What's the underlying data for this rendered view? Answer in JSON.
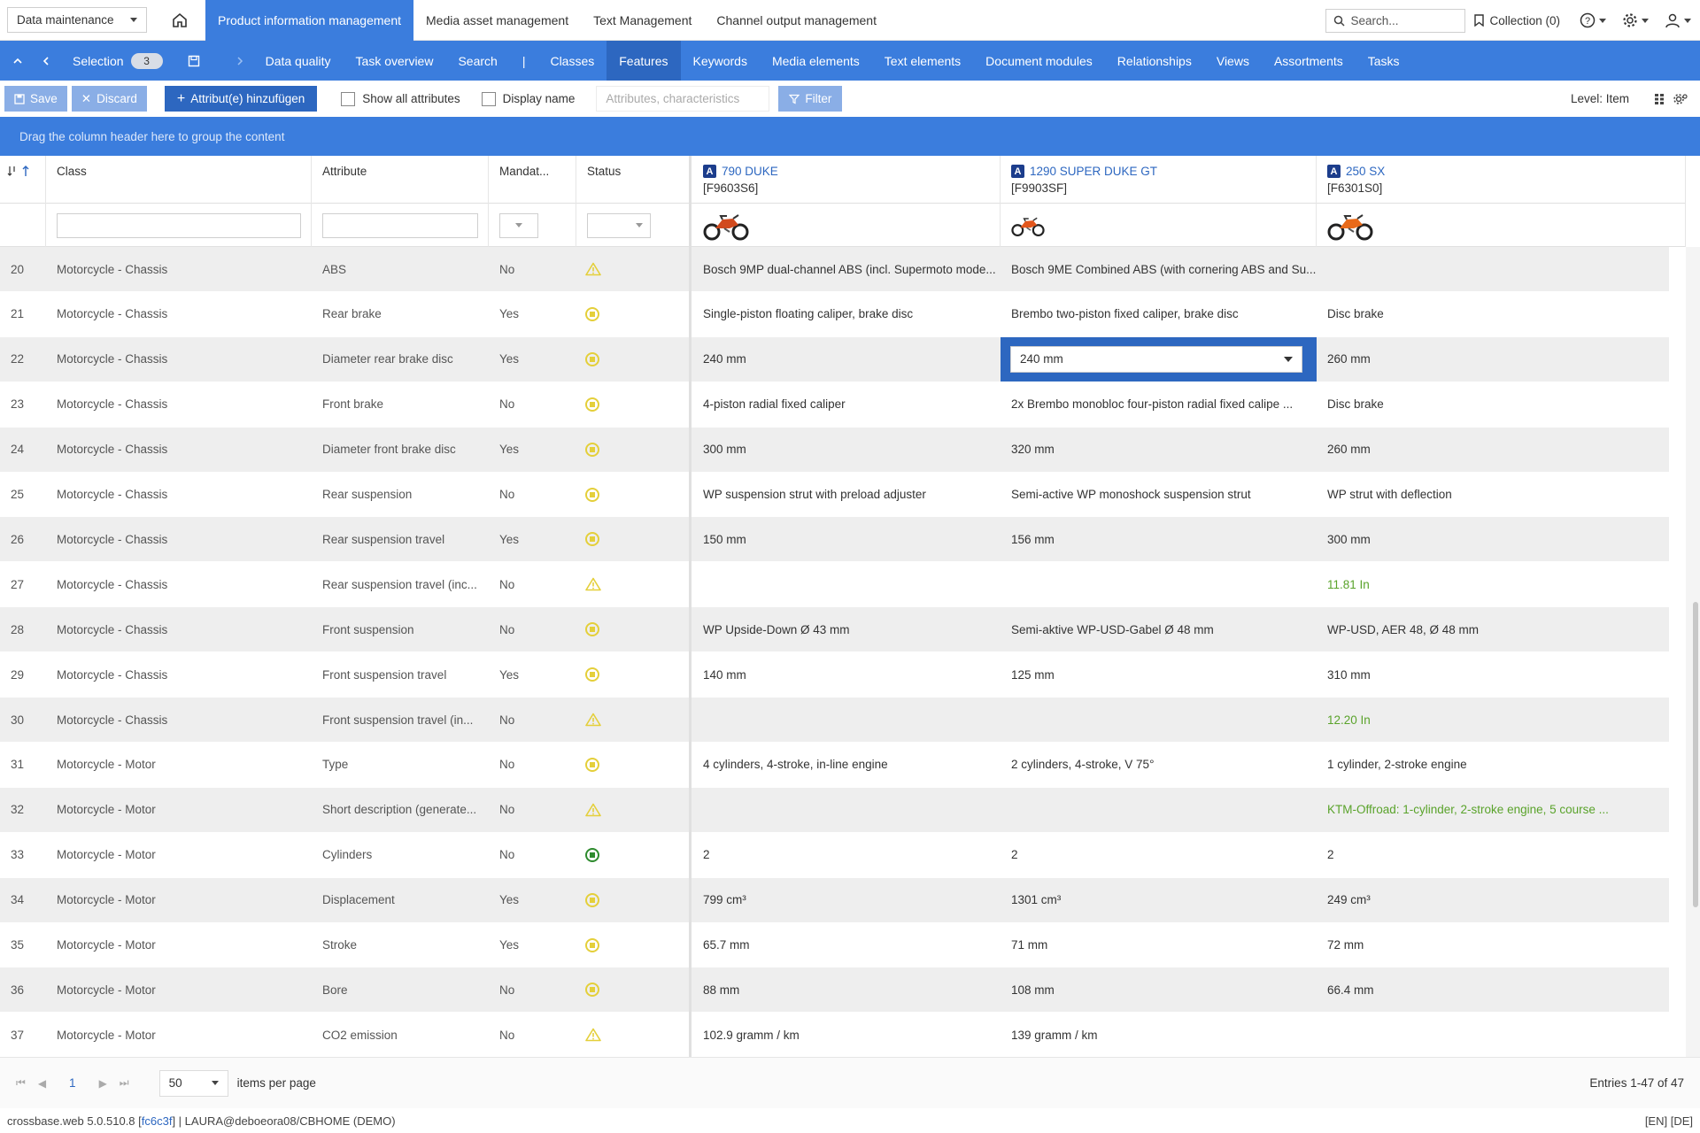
{
  "topbar": {
    "module_select": "Data maintenance",
    "nav": [
      "Product information management",
      "Media asset management",
      "Text Management",
      "Channel output management"
    ],
    "active_nav": 0,
    "search_placeholder": "Search...",
    "collection": "Collection (0)"
  },
  "bluenav": {
    "selection_label": "Selection",
    "selection_count": "3",
    "items": [
      "Data quality",
      "Task overview",
      "Search",
      "|",
      "Classes",
      "Features",
      "Keywords",
      "Media elements",
      "Text elements",
      "Document modules",
      "Relationships",
      "Views",
      "Assortments",
      "Tasks"
    ],
    "active_item": "Features"
  },
  "toolbar": {
    "save": "Save",
    "discard": "Discard",
    "add_attribute": "Attribut(e) hinzufügen",
    "show_all": "Show all attributes",
    "display_name": "Display name",
    "attr_placeholder": "Attributes, characteristics",
    "filter": "Filter",
    "level": "Level: Item"
  },
  "group_hint": "Drag the column header here to group the content",
  "columns": {
    "class": "Class",
    "attribute": "Attribute",
    "mandatory": "Mandat...",
    "status": "Status"
  },
  "products": [
    {
      "badge": "A",
      "name": "790 DUKE",
      "code": "[F9603S6]",
      "bike_color": "#d14a1e"
    },
    {
      "badge": "A",
      "name": "1290 SUPER DUKE GT",
      "code": "[F9903SF]",
      "bike_color": "#e3561c"
    },
    {
      "badge": "A",
      "name": "250 SX",
      "code": "[F6301S0]",
      "bike_color": "#e86a1a"
    }
  ],
  "rows": [
    {
      "n": "20",
      "cls": "Motorcycle - Chassis",
      "attr": "ABS",
      "mand": "No",
      "status": "warn",
      "p1": "Bosch 9MP dual-channel ABS (incl. Supermoto mode...",
      "p2": "Bosch 9ME Combined ABS (with cornering ABS and Su...",
      "p3": "",
      "p3green": false
    },
    {
      "n": "21",
      "cls": "Motorcycle - Chassis",
      "attr": "Rear brake",
      "mand": "Yes",
      "status": "pending",
      "p1": "Single-piston floating caliper, brake disc",
      "p2": "Brembo two-piston fixed caliper, brake disc",
      "p3": "Disc brake",
      "p3green": false
    },
    {
      "n": "22",
      "cls": "Motorcycle - Chassis",
      "attr": "Diameter rear brake disc",
      "mand": "Yes",
      "status": "pending",
      "p1": "240 mm",
      "p2": "240 mm",
      "p3": "260 mm",
      "p3green": false,
      "editing": true
    },
    {
      "n": "23",
      "cls": "Motorcycle - Chassis",
      "attr": "Front brake",
      "mand": "No",
      "status": "pending",
      "p1": "4-piston radial fixed caliper",
      "p2": "2x Brembo monobloc four-piston radial fixed calipe ...",
      "p3": "Disc brake",
      "p3green": false
    },
    {
      "n": "24",
      "cls": "Motorcycle - Chassis",
      "attr": "Diameter front brake disc",
      "mand": "Yes",
      "status": "pending",
      "p1": "300 mm",
      "p2": "320 mm",
      "p3": "260 mm",
      "p3green": false
    },
    {
      "n": "25",
      "cls": "Motorcycle - Chassis",
      "attr": "Rear suspension",
      "mand": "No",
      "status": "pending",
      "p1": "WP suspension strut with preload adjuster",
      "p2": "Semi-active WP monoshock suspension strut",
      "p3": "WP strut with deflection",
      "p3green": false
    },
    {
      "n": "26",
      "cls": "Motorcycle - Chassis",
      "attr": "Rear suspension travel",
      "mand": "Yes",
      "status": "pending",
      "p1": "150 mm",
      "p2": "156 mm",
      "p3": "300 mm",
      "p3green": false
    },
    {
      "n": "27",
      "cls": "Motorcycle - Chassis",
      "attr": "Rear suspension travel (inc...",
      "mand": "No",
      "status": "warn",
      "p1": "",
      "p2": "",
      "p3": "11.81 In",
      "p3green": true
    },
    {
      "n": "28",
      "cls": "Motorcycle - Chassis",
      "attr": "Front suspension",
      "mand": "No",
      "status": "pending",
      "p1": "WP Upside-Down Ø 43 mm",
      "p2": "Semi-aktive WP-USD-Gabel Ø 48 mm",
      "p3": "WP-USD, AER 48, Ø 48 mm",
      "p3green": false
    },
    {
      "n": "29",
      "cls": "Motorcycle - Chassis",
      "attr": "Front suspension travel",
      "mand": "Yes",
      "status": "pending",
      "p1": "140 mm",
      "p2": "125 mm",
      "p3": "310 mm",
      "p3green": false
    },
    {
      "n": "30",
      "cls": "Motorcycle - Chassis",
      "attr": "Front suspension travel (in...",
      "mand": "No",
      "status": "warn",
      "p1": "",
      "p2": "",
      "p3": "12.20 In",
      "p3green": true
    },
    {
      "n": "31",
      "cls": "Motorcycle - Motor",
      "attr": "Type",
      "mand": "No",
      "status": "pending",
      "p1": "4 cylinders, 4-stroke, in-line engine",
      "p2": "2 cylinders, 4-stroke, V 75°",
      "p3": "1 cylinder, 2-stroke engine",
      "p3green": false
    },
    {
      "n": "32",
      "cls": "Motorcycle - Motor",
      "attr": "Short description (generate...",
      "mand": "No",
      "status": "warn",
      "p1": "",
      "p2": "",
      "p3": "KTM-Offroad: 1-cylinder, 2-stroke engine, 5 course ...",
      "p3green": true
    },
    {
      "n": "33",
      "cls": "Motorcycle - Motor",
      "attr": "Cylinders",
      "mand": "No",
      "status": "ok",
      "p1": "2",
      "p2": "2",
      "p3": "2",
      "p3green": false
    },
    {
      "n": "34",
      "cls": "Motorcycle - Motor",
      "attr": "Displacement",
      "mand": "Yes",
      "status": "pending",
      "p1": "799 cm³",
      "p2": "1301 cm³",
      "p3": "249 cm³",
      "p3green": false
    },
    {
      "n": "35",
      "cls": "Motorcycle - Motor",
      "attr": "Stroke",
      "mand": "Yes",
      "status": "pending",
      "p1": "65.7 mm",
      "p2": "71 mm",
      "p3": "72 mm",
      "p3green": false
    },
    {
      "n": "36",
      "cls": "Motorcycle - Motor",
      "attr": "Bore",
      "mand": "No",
      "status": "pending",
      "p1": "88 mm",
      "p2": "108 mm",
      "p3": "66.4 mm",
      "p3green": false
    },
    {
      "n": "37",
      "cls": "Motorcycle - Motor",
      "attr": "CO2 emission",
      "mand": "No",
      "status": "warn",
      "p1": "102.9 gramm / km",
      "p2": "139 gramm / km",
      "p3": "",
      "p3green": false
    }
  ],
  "pager": {
    "page": "1",
    "items_per_page": "50",
    "items_per_page_label": "items per page",
    "entries": "Entries 1-47 of 47"
  },
  "statusbar": {
    "version_prefix": "crossbase.web 5.0.510.8 [",
    "build": "fc6c3f",
    "version_suffix": "] | LAURA@deboeora08/CBHOME (DEMO)",
    "lang": "[EN] [DE]"
  },
  "colors": {
    "primary": "#3b7ddd",
    "primary_dark": "#2d67c0",
    "warn": "#e4cf3a",
    "ok": "#2e8b2e",
    "green_text": "#5aa32b"
  }
}
